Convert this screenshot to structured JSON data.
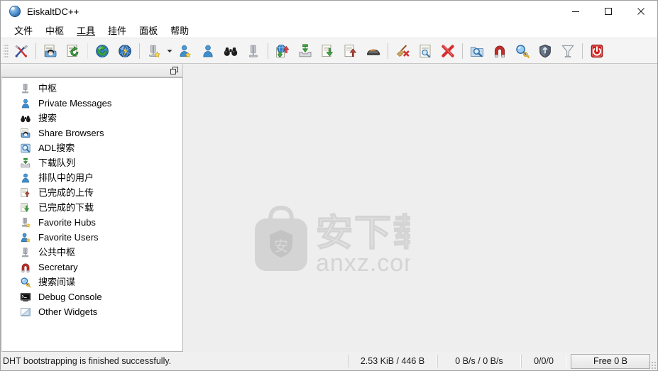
{
  "window": {
    "title": "EiskaltDC++",
    "app_icon": "globe-icon",
    "controls": {
      "minimize": "minimize-icon",
      "maximize": "maximize-icon",
      "close": "close-icon"
    }
  },
  "menubar": {
    "items": [
      {
        "label": "文件",
        "name": "menu-file"
      },
      {
        "label": "中枢",
        "name": "menu-hubs"
      },
      {
        "label": "工具",
        "name": "menu-tools",
        "underlined": true
      },
      {
        "label": "挂件",
        "name": "menu-widgets"
      },
      {
        "label": "面板",
        "name": "menu-panels"
      },
      {
        "label": "帮助",
        "name": "menu-help"
      }
    ]
  },
  "toolbar": {
    "buttons": [
      {
        "name": "settings-tools-icon",
        "icon": "screwdriver-wrench"
      },
      {
        "type": "separator"
      },
      {
        "name": "hash-progress-icon",
        "icon": "document-penguin"
      },
      {
        "name": "refresh-share-icon",
        "icon": "document-refresh"
      },
      {
        "type": "separator-thin"
      },
      {
        "name": "quick-connect-icon",
        "icon": "globe-green"
      },
      {
        "name": "reconnect-icon",
        "icon": "globe-blue"
      },
      {
        "type": "separator"
      },
      {
        "name": "favorite-hubs-icon",
        "icon": "hub-star",
        "has_dropdown": true
      },
      {
        "name": "favorite-users-icon",
        "icon": "user-star"
      },
      {
        "name": "queued-users-icon",
        "icon": "user-blue"
      },
      {
        "name": "search-icon",
        "icon": "binoculars"
      },
      {
        "name": "public-hubs-icon",
        "icon": "hub"
      },
      {
        "type": "separator"
      },
      {
        "name": "adl-search-icon",
        "icon": "globe-arrow"
      },
      {
        "name": "download-queue-icon",
        "icon": "tray-down"
      },
      {
        "name": "finished-downloads-icon",
        "icon": "doc-down-green"
      },
      {
        "name": "finished-uploads-icon",
        "icon": "doc-up-red"
      },
      {
        "name": "spy-frame-icon",
        "icon": "helmet"
      },
      {
        "type": "separator"
      },
      {
        "name": "clear-icon",
        "icon": "broom-x"
      },
      {
        "name": "file-list-icon",
        "icon": "doc-magnifier"
      },
      {
        "name": "remove-icon",
        "icon": "red-x"
      },
      {
        "type": "separator"
      },
      {
        "name": "search-spy-icon",
        "icon": "folder-magnifier"
      },
      {
        "name": "magnet-icon",
        "icon": "magnet"
      },
      {
        "name": "search-key-icon",
        "icon": "magnifier-key"
      },
      {
        "name": "security-icon",
        "icon": "shield"
      },
      {
        "name": "filter-icon",
        "icon": "funnel"
      },
      {
        "type": "separator"
      },
      {
        "name": "quit-icon",
        "icon": "power-red"
      }
    ]
  },
  "dock": {
    "float_button": "restore-window-icon",
    "items": [
      {
        "label": "中枢",
        "icon": "hub-icon",
        "name": "sidebar-item-hubs"
      },
      {
        "label": "Private Messages",
        "icon": "user-icon",
        "name": "sidebar-item-private-messages"
      },
      {
        "label": "搜索",
        "icon": "binoculars-icon",
        "name": "sidebar-item-search"
      },
      {
        "label": "Share Browsers",
        "icon": "share-browser-icon",
        "name": "sidebar-item-share-browsers"
      },
      {
        "label": "ADL搜索",
        "icon": "adl-search-icon",
        "name": "sidebar-item-adl-search"
      },
      {
        "label": "下载队列",
        "icon": "download-queue-icon",
        "name": "sidebar-item-download-queue"
      },
      {
        "label": "排队中的用户",
        "icon": "user-icon",
        "name": "sidebar-item-queued-users"
      },
      {
        "label": "已完成的上传",
        "icon": "doc-up-icon",
        "name": "sidebar-item-finished-uploads"
      },
      {
        "label": "已完成的下载",
        "icon": "doc-down-icon",
        "name": "sidebar-item-finished-downloads"
      },
      {
        "label": "Favorite Hubs",
        "icon": "hub-star-icon",
        "name": "sidebar-item-favorite-hubs"
      },
      {
        "label": "Favorite Users",
        "icon": "user-star-icon",
        "name": "sidebar-item-favorite-users"
      },
      {
        "label": "公共中枢",
        "icon": "hub-icon",
        "name": "sidebar-item-public-hubs"
      },
      {
        "label": "Secretary",
        "icon": "magnet-icon",
        "name": "sidebar-item-secretary"
      },
      {
        "label": "搜索间谍",
        "icon": "search-spy-icon",
        "name": "sidebar-item-search-spy"
      },
      {
        "label": "Debug Console",
        "icon": "console-icon",
        "name": "sidebar-item-debug-console"
      },
      {
        "label": "Other Widgets",
        "icon": "chart-icon",
        "name": "sidebar-item-other-widgets"
      }
    ]
  },
  "watermark": {
    "text_cn": "安下载",
    "text_en": "anxz.com",
    "logo_char": "安",
    "color": "#d2d2d2"
  },
  "statusbar": {
    "message": "DHT bootstrapping is finished successfully.",
    "ratio": "2.53 KiB / 446 B",
    "speed": "0 B/s / 0 B/s",
    "slots": "0/0/0",
    "free_space": "Free 0 B"
  },
  "colors": {
    "window_bg": "#f0f0f0",
    "mdi_bg": "#eeeeee",
    "toolbar_bg": "#f4f4f4",
    "list_bg": "#ffffff",
    "accent": "#cde8ff"
  }
}
